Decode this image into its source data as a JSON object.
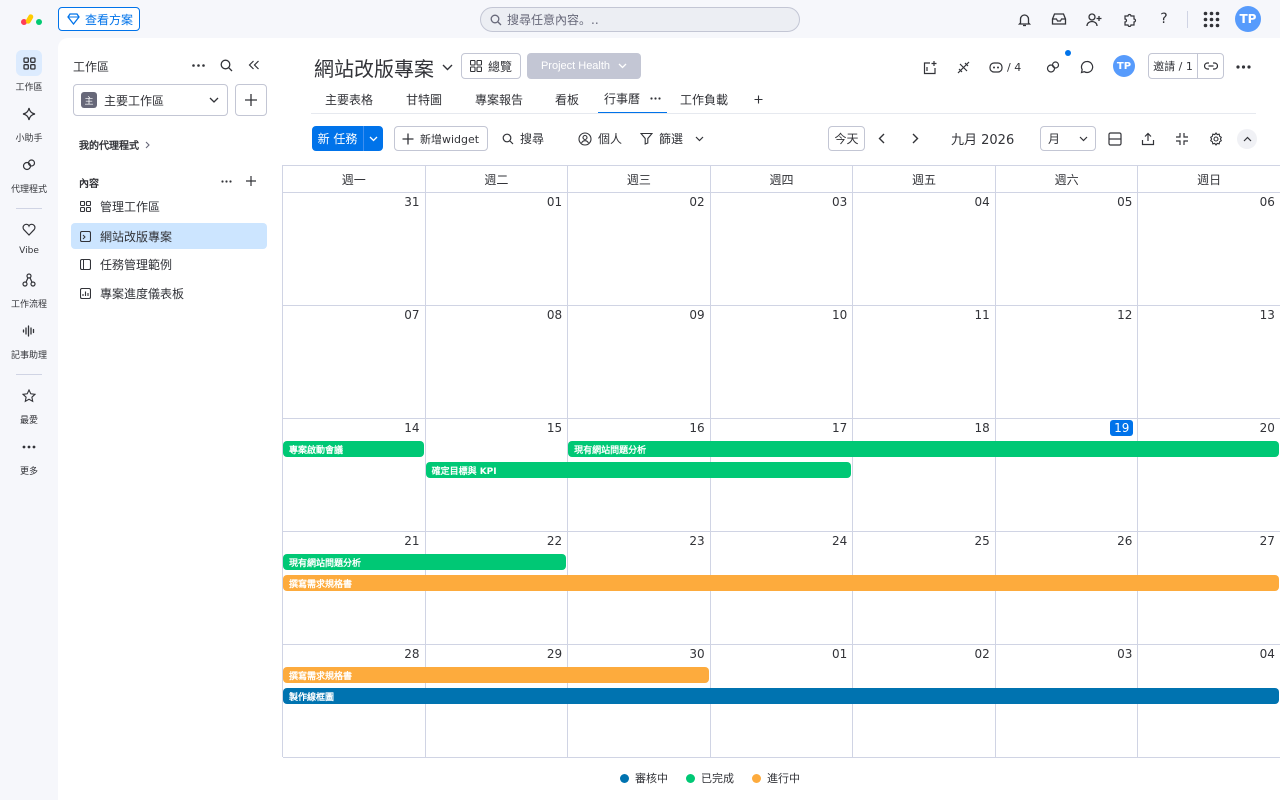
{
  "topbar": {
    "plans_label": "查看方案",
    "search_placeholder": "搜尋任意內容。..",
    "avatar_initials": "TP",
    "icons": [
      "bell-icon",
      "inbox-icon",
      "invite-member-icon",
      "apps-puzzle-icon",
      "help-icon",
      "app-grid-icon"
    ]
  },
  "rail": {
    "items": [
      {
        "label": "工作區",
        "icon": "workspace-grid-icon",
        "active": true
      },
      {
        "label": "小助手",
        "icon": "sparkle-icon"
      },
      {
        "label": "代理程式",
        "icon": "agent-icon"
      },
      {
        "label": "Vibe",
        "icon": "heart-icon"
      },
      {
        "label": "工作流程",
        "icon": "workflow-icon"
      },
      {
        "label": "記事助理",
        "icon": "soundwave-icon"
      },
      {
        "label": "最愛",
        "icon": "star-icon"
      },
      {
        "label": "更多",
        "icon": "more-dots-icon"
      }
    ]
  },
  "sidebar": {
    "title": "工作區",
    "workspace": {
      "badge": "主",
      "name": "主要工作區"
    },
    "my_agents": "我的代理程式",
    "content_label": "內容",
    "items": [
      {
        "label": "管理工作區"
      },
      {
        "label": "網站改版專案",
        "active": true
      },
      {
        "label": "任務管理範例"
      },
      {
        "label": "專案進度儀表板"
      }
    ]
  },
  "board": {
    "title": "網站改版專案",
    "overview_label": "總覽",
    "health_label": "Project Health",
    "agents_count": "/ 4",
    "avatar_initials": "TP",
    "invite_label": "邀請 / 1",
    "tabs": [
      "主要表格",
      "甘特圖",
      "專案報告",
      "看板",
      "行事曆",
      "工作負載"
    ],
    "active_tab": "行事曆"
  },
  "toolbar": {
    "new_task": "新 任務",
    "add_widget": "新增widget",
    "search": "搜尋",
    "person": "個人",
    "filter": "篩選",
    "today": "今天",
    "month_label": "九月 2026",
    "view_select": "月"
  },
  "calendar": {
    "weekdays": [
      "週一",
      "週二",
      "週三",
      "週四",
      "週五",
      "週六",
      "週日"
    ],
    "weeks": [
      [
        "31",
        "01",
        "02",
        "03",
        "04",
        "05",
        "06"
      ],
      [
        "07",
        "08",
        "09",
        "10",
        "11",
        "12",
        "13"
      ],
      [
        "14",
        "15",
        "16",
        "17",
        "18",
        "19",
        "20"
      ],
      [
        "21",
        "22",
        "23",
        "24",
        "25",
        "26",
        "27"
      ],
      [
        "28",
        "29",
        "30",
        "01",
        "02",
        "03",
        "04"
      ]
    ],
    "today": "19",
    "events": [
      {
        "name": "專案啟動會議",
        "week": 2,
        "start": 0,
        "end": 1,
        "lane": 0,
        "status": "已完成"
      },
      {
        "name": "現有網站問題分析",
        "week": 2,
        "start": 2,
        "end": 7,
        "lane": 0,
        "status": "已完成"
      },
      {
        "name": "確定目標與 KPI",
        "week": 2,
        "start": 1,
        "end": 4,
        "lane": 1,
        "status": "已完成"
      },
      {
        "name": "現有網站問題分析",
        "week": 3,
        "start": 0,
        "end": 2,
        "lane": 0,
        "status": "已完成"
      },
      {
        "name": "撰寫需求規格書",
        "week": 3,
        "start": 0,
        "end": 7,
        "lane": 1,
        "status": "進行中"
      },
      {
        "name": "撰寫需求規格書",
        "week": 4,
        "start": 0,
        "end": 3,
        "lane": 0,
        "status": "進行中"
      },
      {
        "name": "製作線框圖",
        "week": 4,
        "start": 0,
        "end": 7,
        "lane": 1,
        "status": "審核中"
      }
    ]
  },
  "legend": [
    {
      "label": "審核中",
      "color": "#0073b0"
    },
    {
      "label": "已完成",
      "color": "#00c875"
    },
    {
      "label": "進行中",
      "color": "#fdab3d"
    }
  ]
}
